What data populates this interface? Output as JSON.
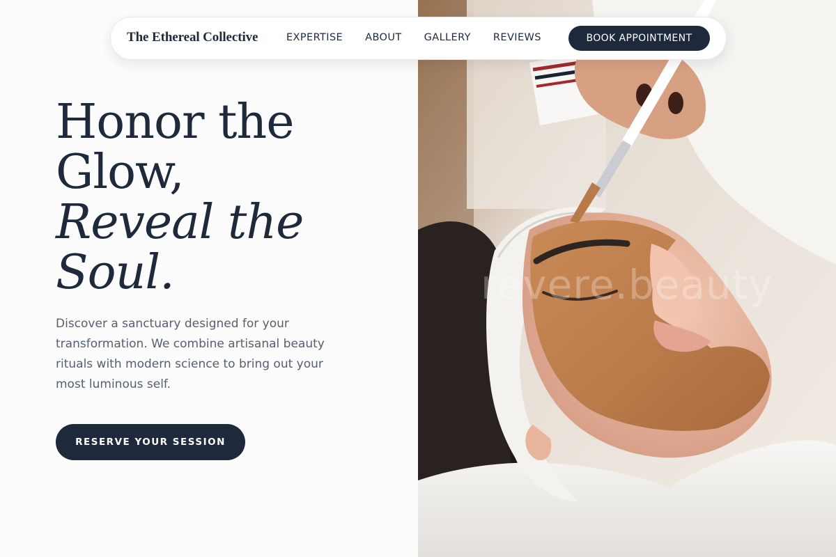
{
  "brand": {
    "name": "The Ethereal Collective"
  },
  "nav": {
    "links": [
      "EXPERTISE",
      "ABOUT",
      "GALLERY",
      "REVIEWS"
    ],
    "cta_label": "BOOK APPOINTMENT"
  },
  "hero": {
    "headline_line1": "Honor the",
    "headline_line2": "Glow,",
    "headline_italic_line1": "Reveal the",
    "headline_italic_line2": "Soul.",
    "intro": "Discover a sanctuary designed for your transformation. We combine artisanal beauty rituals with modern science to bring out your most luminous self.",
    "cta_label": "RESERVE YOUR SESSION"
  },
  "photo": {
    "watermark": "revere.beauty"
  },
  "colors": {
    "navy": "#1e293b",
    "body_text": "#55606e",
    "background": "#fcfcfc"
  }
}
